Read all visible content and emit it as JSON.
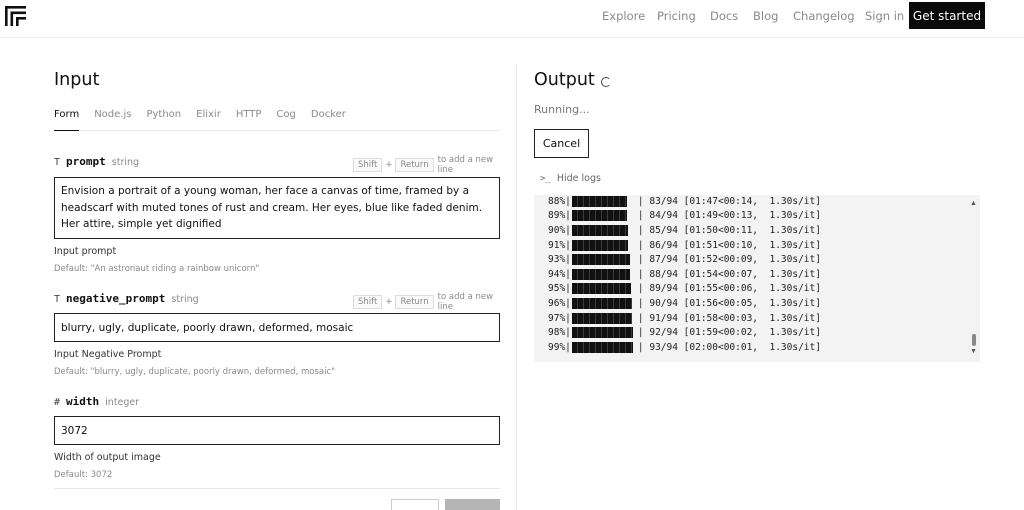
{
  "nav": {
    "items": [
      "Explore",
      "Pricing",
      "Docs",
      "Blog",
      "Changelog",
      "Sign in"
    ],
    "cta": "Get started"
  },
  "input": {
    "title": "Input",
    "tabs": [
      "Form",
      "Node.js",
      "Python",
      "Elixir",
      "HTTP",
      "Cog",
      "Docker"
    ],
    "active_tab": "Form",
    "hint": {
      "key1": "Shift",
      "plus": "+",
      "key2": "Return",
      "text": "to add a new line"
    },
    "fields": {
      "prompt": {
        "icon": "T",
        "name": "prompt",
        "type": "string",
        "value": "Envision a portrait of a young woman, her face a canvas of time, framed by a headscarf with muted tones of rust and cream. Her eyes, blue like faded denim. Her attire, simple yet dignified",
        "help": "Input prompt",
        "default": "Default: \"An astronaut riding a rainbow unicorn\""
      },
      "negative_prompt": {
        "icon": "T",
        "name": "negative_prompt",
        "type": "string",
        "value": "blurry, ugly, duplicate, poorly drawn, deformed, mosaic",
        "help": "Input Negative Prompt",
        "default": "Default: \"blurry, ugly, duplicate, poorly drawn, deformed, mosaic\""
      },
      "width": {
        "icon": "#",
        "name": "width",
        "type": "integer",
        "value": "3072",
        "help": "Width of output image",
        "default": "Default: 3072"
      }
    }
  },
  "output": {
    "title": "Output",
    "status": "Running...",
    "cancel": "Cancel",
    "hide_logs": "Hide logs",
    "logs": [
      {
        "pct": "88%",
        "progress": 0.88,
        "rest": " 83/94 [01:47<00:14,  1.30s/it]"
      },
      {
        "pct": "89%",
        "progress": 0.89,
        "rest": " 84/94 [01:49<00:13,  1.30s/it]"
      },
      {
        "pct": "90%",
        "progress": 0.9,
        "rest": " 85/94 [01:50<00:11,  1.30s/it]"
      },
      {
        "pct": "91%",
        "progress": 0.91,
        "rest": " 86/94 [01:51<00:10,  1.30s/it]"
      },
      {
        "pct": "93%",
        "progress": 0.93,
        "rest": " 87/94 [01:52<00:09,  1.30s/it]"
      },
      {
        "pct": "94%",
        "progress": 0.94,
        "rest": " 88/94 [01:54<00:07,  1.30s/it]"
      },
      {
        "pct": "95%",
        "progress": 0.95,
        "rest": " 89/94 [01:55<00:06,  1.30s/it]"
      },
      {
        "pct": "96%",
        "progress": 0.96,
        "rest": " 90/94 [01:56<00:05,  1.30s/it]"
      },
      {
        "pct": "97%",
        "progress": 0.97,
        "rest": " 91/94 [01:58<00:03,  1.30s/it]"
      },
      {
        "pct": "98%",
        "progress": 0.98,
        "rest": " 92/94 [01:59<00:02,  1.30s/it]"
      },
      {
        "pct": "99%",
        "progress": 0.99,
        "rest": " 93/94 [02:00<00:01,  1.30s/it]"
      }
    ]
  }
}
